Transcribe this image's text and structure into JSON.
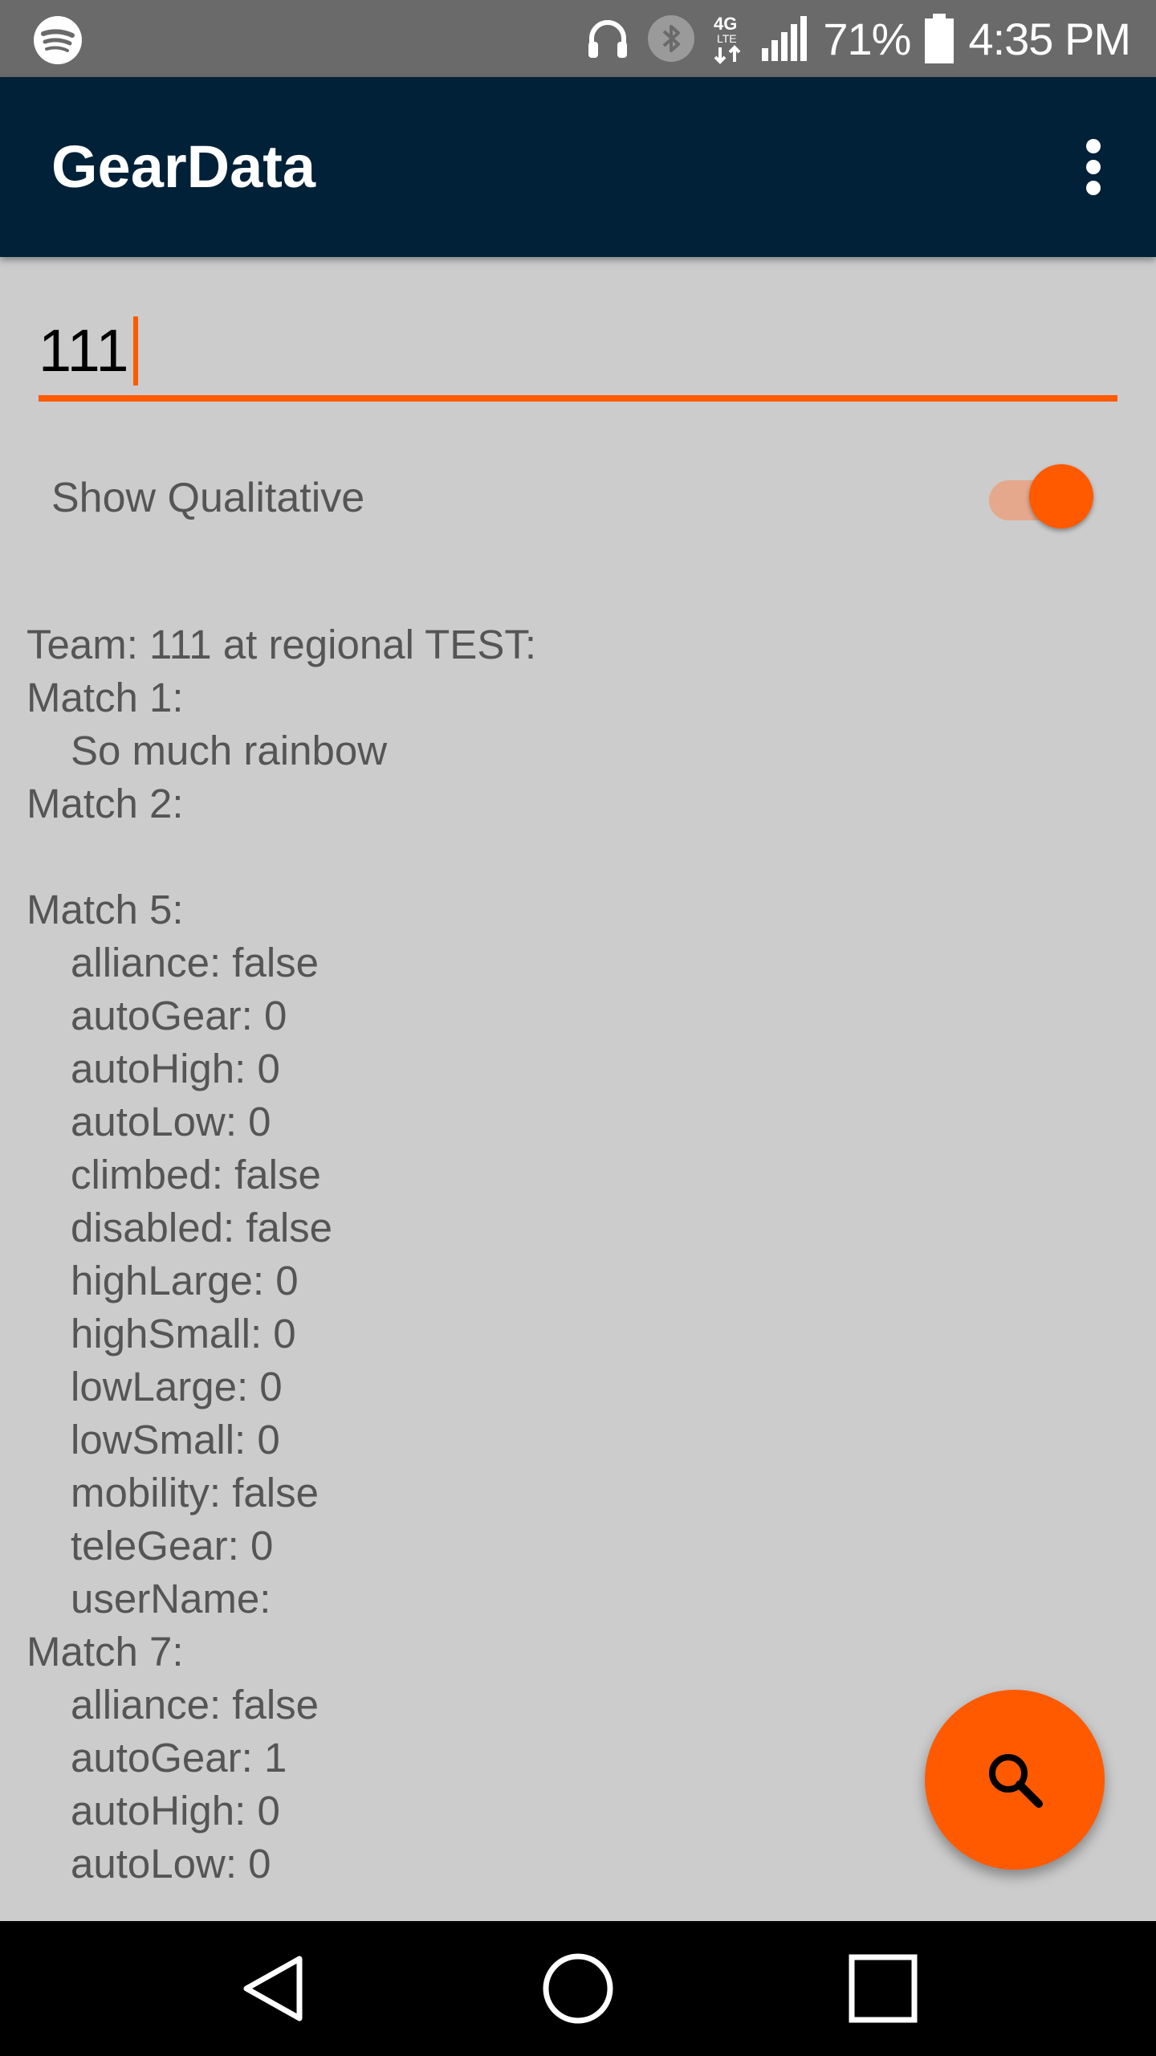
{
  "status_bar": {
    "battery_percent": "71%",
    "time": "4:35 PM",
    "network_type": "4G LTE",
    "icons": [
      "spotify-icon",
      "headphones-icon",
      "bluetooth-icon",
      "network-4g-lte-icon",
      "signal-icon",
      "battery-icon"
    ]
  },
  "app_bar": {
    "title": "GearData",
    "menu_icon": "more-vert-icon"
  },
  "search": {
    "value": "111"
  },
  "toggle": {
    "label": "Show Qualitative",
    "checked": true
  },
  "results": {
    "lines": [
      {
        "text": "Team: 111 at regional TEST:",
        "indent": false
      },
      {
        "text": "Match 1:",
        "indent": false
      },
      {
        "text": "So much rainbow",
        "indent": true
      },
      {
        "text": "Match 2:",
        "indent": false
      },
      {
        "text": "",
        "indent": false
      },
      {
        "text": "Match 5:",
        "indent": false
      },
      {
        "text": "alliance: false",
        "indent": true
      },
      {
        "text": "autoGear: 0",
        "indent": true
      },
      {
        "text": "autoHigh: 0",
        "indent": true
      },
      {
        "text": "autoLow: 0",
        "indent": true
      },
      {
        "text": "climbed: false",
        "indent": true
      },
      {
        "text": "disabled: false",
        "indent": true
      },
      {
        "text": "highLarge: 0",
        "indent": true
      },
      {
        "text": "highSmall: 0",
        "indent": true
      },
      {
        "text": "lowLarge: 0",
        "indent": true
      },
      {
        "text": "lowSmall: 0",
        "indent": true
      },
      {
        "text": "mobility: false",
        "indent": true
      },
      {
        "text": "teleGear: 0",
        "indent": true
      },
      {
        "text": "userName:",
        "indent": true
      },
      {
        "text": "Match 7:",
        "indent": false
      },
      {
        "text": "alliance: false",
        "indent": true
      },
      {
        "text": "autoGear: 1",
        "indent": true
      },
      {
        "text": "autoHigh: 0",
        "indent": true
      },
      {
        "text": "autoLow: 0",
        "indent": true
      }
    ]
  },
  "fab": {
    "icon": "search-icon"
  },
  "nav_bar": {
    "buttons": [
      "back-icon",
      "home-icon",
      "recents-icon"
    ]
  },
  "colors": {
    "accent": "#ff5a00",
    "app_bar": "#002137",
    "background": "#cccccc",
    "status_bar": "#6a6a6a",
    "text_secondary": "#555555"
  }
}
